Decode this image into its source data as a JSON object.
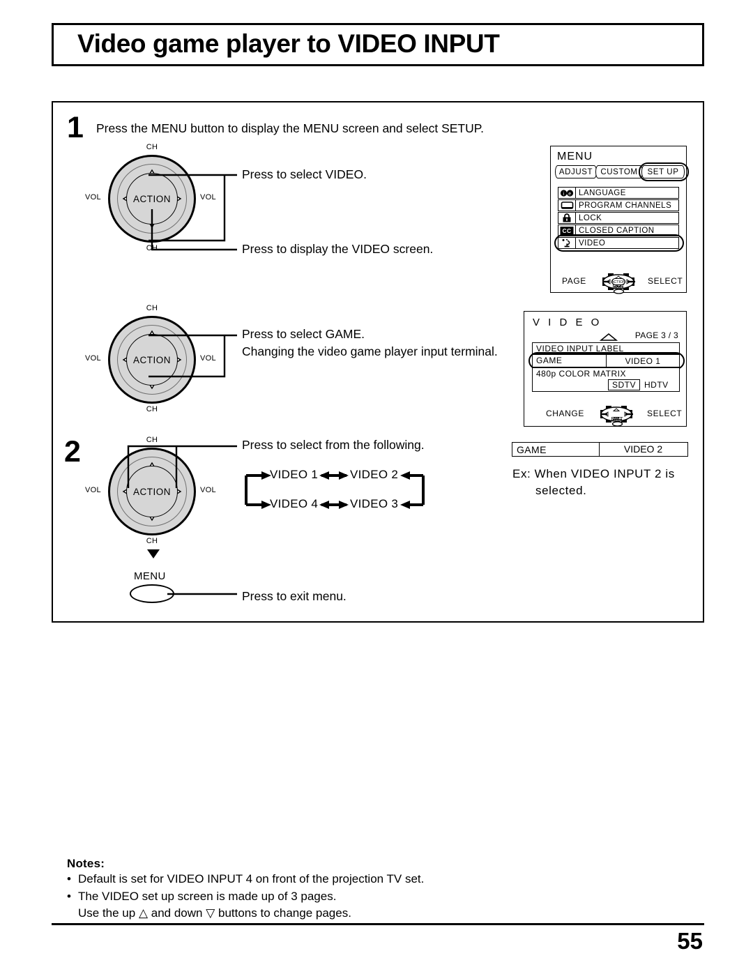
{
  "title": "Video game player to VIDEO INPUT",
  "page_number": "55",
  "steps": [
    {
      "number": "1",
      "text": "Press the MENU button to display the MENU screen and select SETUP.",
      "callouts": [
        "Press to select VIDEO.",
        "Press to display the VIDEO screen.",
        "Press to select  GAME.",
        "Changing the video game player input terminal."
      ]
    },
    {
      "number": "2",
      "text": "Press to select from the following.",
      "exit_text": "Press to exit menu."
    }
  ],
  "dial": {
    "center_label": "ACTION",
    "ch_top": "CH",
    "ch_bottom": "CH",
    "vol_left": "VOL",
    "vol_right": "VOL"
  },
  "menu_button": {
    "label": "MENU"
  },
  "cycle": {
    "items": [
      "VIDEO 1",
      "VIDEO 2",
      "VIDEO 4",
      "VIDEO 3"
    ]
  },
  "osd_menu": {
    "header": "MENU",
    "tabs": [
      "ADJUST",
      "CUSTOM",
      "SET UP"
    ],
    "selected_tab": "SET UP",
    "rows": [
      {
        "icon": "language-icon",
        "label": "LANGUAGE"
      },
      {
        "icon": "tv-screen-icon",
        "label": "PROGRAM  CHANNELS"
      },
      {
        "icon": "padlock-icon",
        "label": "LOCK"
      },
      {
        "icon": "closed-caption-icon",
        "label": "CLOSED  CAPTION"
      },
      {
        "icon": "joystick-icon",
        "label": "VIDEO"
      }
    ],
    "selected_row": "VIDEO",
    "footer_left": "PAGE",
    "footer_right": "SELECT",
    "footer_center": "ACTION",
    "footer_exit": "EXIT"
  },
  "osd_video": {
    "header": "V I D E O",
    "page_indicator": "PAGE 3 / 3",
    "section_label": "VIDEO  INPUT  LABEL",
    "game_label": "GAME",
    "game_value": "VIDEO 1",
    "matrix_label": "480p  COLOR MATRIX",
    "matrix_options": [
      "SDTV",
      "HDTV"
    ],
    "matrix_selected": "SDTV",
    "footer_left": "CHANGE",
    "footer_right": "SELECT",
    "footer_center": "ACTION",
    "footer_exit": "EXIT"
  },
  "example": {
    "game_label": "GAME",
    "game_value": "VIDEO 2",
    "caption_line1": "Ex: When VIDEO INPUT 2 is",
    "caption_line2": "selected."
  },
  "notes": {
    "heading": "Notes:",
    "items": [
      "Default is set for VIDEO INPUT 4 on front of the projection TV set.",
      "The VIDEO set up screen is made up of 3 pages."
    ],
    "sub_item": "Use the up △ and down ▽ buttons to change pages."
  }
}
